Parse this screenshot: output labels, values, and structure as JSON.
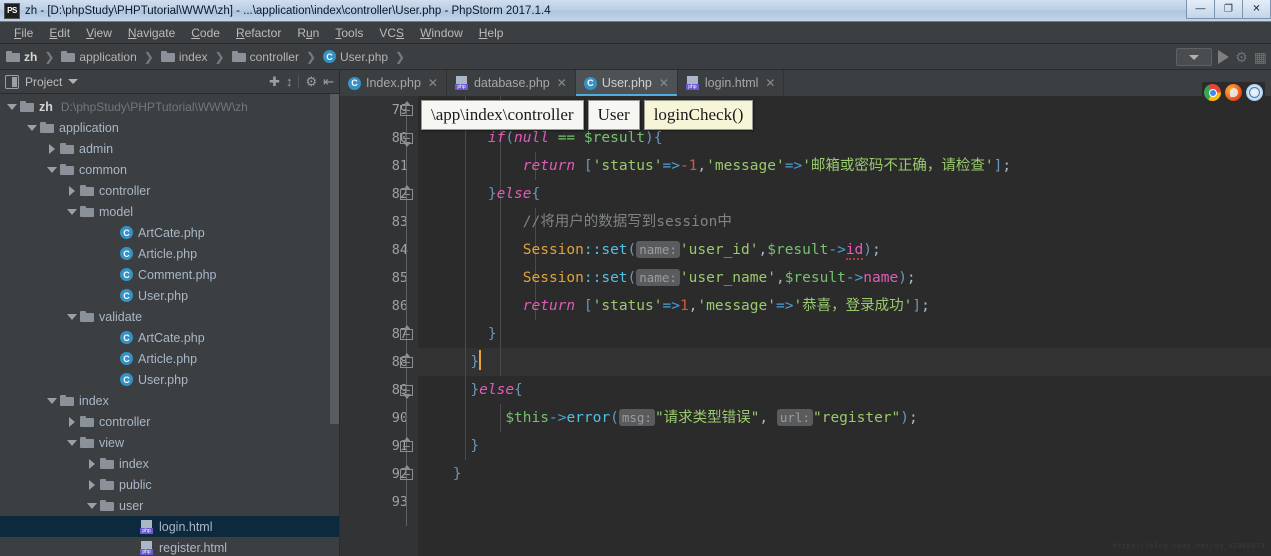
{
  "window": {
    "title": "zh - [D:\\phpStudy\\PHPTutorial\\WWW\\zh] - ...\\application\\index\\controller\\User.php - PhpStorm 2017.1.4",
    "app_icon_label": "PS",
    "controls": {
      "minimize": "—",
      "maximize": "❐",
      "close": "✕"
    }
  },
  "menubar": {
    "items": [
      {
        "pre": "",
        "mn": "F",
        "post": "ile"
      },
      {
        "pre": "",
        "mn": "E",
        "post": "dit"
      },
      {
        "pre": "",
        "mn": "V",
        "post": "iew"
      },
      {
        "pre": "",
        "mn": "N",
        "post": "avigate"
      },
      {
        "pre": "",
        "mn": "C",
        "post": "ode"
      },
      {
        "pre": "",
        "mn": "R",
        "post": "efactor"
      },
      {
        "pre": "R",
        "mn": "u",
        "post": "n"
      },
      {
        "pre": "",
        "mn": "T",
        "post": "ools"
      },
      {
        "pre": "VC",
        "mn": "S",
        "post": ""
      },
      {
        "pre": "",
        "mn": "W",
        "post": "indow"
      },
      {
        "pre": "",
        "mn": "H",
        "post": "elp"
      }
    ]
  },
  "navbar": {
    "crumbs": [
      {
        "label": "zh",
        "icon": "folder-icon",
        "bold": true
      },
      {
        "label": "application",
        "icon": "folder-icon",
        "bold": false
      },
      {
        "label": "index",
        "icon": "folder-icon",
        "bold": false
      },
      {
        "label": "controller",
        "icon": "folder-icon",
        "bold": false
      },
      {
        "label": "User.php",
        "icon": "php-class-icon",
        "bold": false
      }
    ],
    "separator": "❯"
  },
  "project_panel": {
    "title": "Project",
    "icons": [
      "locate-icon",
      "collapse-all-icon",
      "settings-gear-icon",
      "hide-panel-icon"
    ],
    "tree": [
      {
        "depth": 0,
        "twist": "open",
        "icon": "folder-icon",
        "label": "zh",
        "bold": true,
        "path": "D:\\phpStudy\\PHPTutorial\\WWW\\zh",
        "selected": false
      },
      {
        "depth": 1,
        "twist": "open",
        "icon": "folder-icon",
        "label": "application",
        "bold": false,
        "path": "",
        "selected": false
      },
      {
        "depth": 2,
        "twist": "closed",
        "icon": "folder-icon",
        "label": "admin",
        "bold": false,
        "path": "",
        "selected": false
      },
      {
        "depth": 2,
        "twist": "open",
        "icon": "folder-icon",
        "label": "common",
        "bold": false,
        "path": "",
        "selected": false
      },
      {
        "depth": 3,
        "twist": "closed",
        "icon": "folder-icon",
        "label": "controller",
        "bold": false,
        "path": "",
        "selected": false
      },
      {
        "depth": 3,
        "twist": "open",
        "icon": "folder-icon",
        "label": "model",
        "bold": false,
        "path": "",
        "selected": false
      },
      {
        "depth": 5,
        "twist": "none",
        "icon": "php-class-icon",
        "label": "ArtCate.php",
        "bold": false,
        "path": "",
        "selected": false
      },
      {
        "depth": 5,
        "twist": "none",
        "icon": "php-class-icon",
        "label": "Article.php",
        "bold": false,
        "path": "",
        "selected": false
      },
      {
        "depth": 5,
        "twist": "none",
        "icon": "php-class-icon",
        "label": "Comment.php",
        "bold": false,
        "path": "",
        "selected": false
      },
      {
        "depth": 5,
        "twist": "none",
        "icon": "php-class-icon",
        "label": "User.php",
        "bold": false,
        "path": "",
        "selected": false
      },
      {
        "depth": 3,
        "twist": "open",
        "icon": "folder-icon",
        "label": "validate",
        "bold": false,
        "path": "",
        "selected": false
      },
      {
        "depth": 5,
        "twist": "none",
        "icon": "php-class-icon",
        "label": "ArtCate.php",
        "bold": false,
        "path": "",
        "selected": false
      },
      {
        "depth": 5,
        "twist": "none",
        "icon": "php-class-icon",
        "label": "Article.php",
        "bold": false,
        "path": "",
        "selected": false
      },
      {
        "depth": 5,
        "twist": "none",
        "icon": "php-class-icon",
        "label": "User.php",
        "bold": false,
        "path": "",
        "selected": false
      },
      {
        "depth": 2,
        "twist": "open",
        "icon": "folder-icon",
        "label": "index",
        "bold": false,
        "path": "",
        "selected": false
      },
      {
        "depth": 3,
        "twist": "closed",
        "icon": "folder-icon",
        "label": "controller",
        "bold": false,
        "path": "",
        "selected": false
      },
      {
        "depth": 3,
        "twist": "open",
        "icon": "folder-icon",
        "label": "view",
        "bold": false,
        "path": "",
        "selected": false
      },
      {
        "depth": 4,
        "twist": "closed",
        "icon": "folder-icon",
        "label": "index",
        "bold": false,
        "path": "",
        "selected": false
      },
      {
        "depth": 4,
        "twist": "closed",
        "icon": "folder-icon",
        "label": "public",
        "bold": false,
        "path": "",
        "selected": false
      },
      {
        "depth": 4,
        "twist": "open",
        "icon": "folder-icon",
        "label": "user",
        "bold": false,
        "path": "",
        "selected": false
      },
      {
        "depth": 6,
        "twist": "none",
        "icon": "php-file-icon",
        "label": "login.html",
        "bold": false,
        "path": "",
        "selected": true
      },
      {
        "depth": 6,
        "twist": "none",
        "icon": "php-file-icon",
        "label": "register.html",
        "bold": false,
        "path": "",
        "selected": false
      }
    ]
  },
  "tabs": [
    {
      "label": "Index.php",
      "icon": "php-class-icon",
      "active": false,
      "close": "✕"
    },
    {
      "label": "database.php",
      "icon": "php-file-icon",
      "active": false,
      "close": "✕"
    },
    {
      "label": "User.php",
      "icon": "php-class-icon",
      "active": true,
      "close": "✕"
    },
    {
      "label": "login.html",
      "icon": "php-file-icon",
      "active": false,
      "close": "✕"
    }
  ],
  "breadcrumb_popup": [
    {
      "text": "\\app\\index\\controller",
      "highlight": false
    },
    {
      "text": "User",
      "highlight": false
    },
    {
      "text": "loginCheck()",
      "highlight": true
    }
  ],
  "run_toolbar": {
    "config_selector": "run-config-dropdown",
    "run_button": "run-icon",
    "debug_button": "debug-icon",
    "coverage_button": "coverage-icon"
  },
  "browser_bar": [
    "chrome-icon",
    "firefox-icon",
    "safari-icon"
  ],
  "editor": {
    "first_line": 79,
    "current_line": 88,
    "lines": [
      {
        "n": 79,
        "indent": 2,
        "fold": "mid-cap-top",
        "tokens": [
          {
            "t": "        ",
            "c": "t-punc"
          },
          {
            "t": "})",
            "c": "t-brc"
          },
          {
            "t": ";",
            "c": "t-punc"
          }
        ]
      },
      {
        "n": 80,
        "indent": 2,
        "fold": "mid-cap-bottom",
        "tokens": [
          {
            "t": "        ",
            "c": "t-punc"
          },
          {
            "t": "if",
            "c": "t-kw2"
          },
          {
            "t": "(",
            "c": "t-brc"
          },
          {
            "t": "null",
            "c": "t-kw2"
          },
          {
            "t": " ",
            "c": "t-punc"
          },
          {
            "t": "==",
            "c": "t-var"
          },
          {
            "t": " ",
            "c": "t-punc"
          },
          {
            "t": "$result",
            "c": "t-var"
          },
          {
            "t": ")",
            "c": "t-brc"
          },
          {
            "t": "{",
            "c": "t-brc"
          }
        ]
      },
      {
        "n": 81,
        "indent": 3,
        "fold": "none",
        "tokens": [
          {
            "t": "            ",
            "c": "t-punc"
          },
          {
            "t": "return",
            "c": "t-kw2"
          },
          {
            "t": " ",
            "c": "t-punc"
          },
          {
            "t": "[",
            "c": "t-brc"
          },
          {
            "t": "'status'",
            "c": "t-str"
          },
          {
            "t": "=>",
            "c": "t-op"
          },
          {
            "t": "-1",
            "c": "t-num"
          },
          {
            "t": ",",
            "c": "t-punc"
          },
          {
            "t": "'message'",
            "c": "t-str"
          },
          {
            "t": "=>",
            "c": "t-op"
          },
          {
            "t": "'邮箱或密码不正确，请检查'",
            "c": "t-str"
          },
          {
            "t": "]",
            "c": "t-brc"
          },
          {
            "t": ";",
            "c": "t-punc"
          }
        ]
      },
      {
        "n": 82,
        "indent": 2,
        "fold": "cap-top",
        "tokens": [
          {
            "t": "        ",
            "c": "t-punc"
          },
          {
            "t": "}",
            "c": "t-brc"
          },
          {
            "t": "else",
            "c": "t-kw2"
          },
          {
            "t": "{",
            "c": "t-brc"
          }
        ]
      },
      {
        "n": 83,
        "indent": 3,
        "fold": "none",
        "tokens": [
          {
            "t": "            ",
            "c": "t-punc"
          },
          {
            "t": "//将用户的数据写到session中",
            "c": "t-cmt"
          }
        ]
      },
      {
        "n": 84,
        "indent": 3,
        "fold": "none",
        "tokens": [
          {
            "t": "            ",
            "c": "t-punc"
          },
          {
            "t": "Session",
            "c": "t-cls"
          },
          {
            "t": "::",
            "c": "t-fn"
          },
          {
            "t": "set",
            "c": "t-fn"
          },
          {
            "t": "(",
            "c": "t-brc"
          },
          {
            "t": "name:",
            "c": "hint"
          },
          {
            "t": "'user_id'",
            "c": "t-str"
          },
          {
            "t": ",",
            "c": "t-punc"
          },
          {
            "t": "$result",
            "c": "t-var"
          },
          {
            "t": "->",
            "c": "t-op"
          },
          {
            "t": "id",
            "c": "t-prop sq"
          },
          {
            "t": ")",
            "c": "t-brc"
          },
          {
            "t": ";",
            "c": "t-punc"
          }
        ]
      },
      {
        "n": 85,
        "indent": 3,
        "fold": "none",
        "tokens": [
          {
            "t": "            ",
            "c": "t-punc"
          },
          {
            "t": "Session",
            "c": "t-cls"
          },
          {
            "t": "::",
            "c": "t-fn"
          },
          {
            "t": "set",
            "c": "t-fn"
          },
          {
            "t": "(",
            "c": "t-brc"
          },
          {
            "t": "name:",
            "c": "hint"
          },
          {
            "t": "'user_name'",
            "c": "t-str"
          },
          {
            "t": ",",
            "c": "t-punc"
          },
          {
            "t": "$result",
            "c": "t-var"
          },
          {
            "t": "->",
            "c": "t-op"
          },
          {
            "t": "name",
            "c": "t-prop"
          },
          {
            "t": ")",
            "c": "t-brc"
          },
          {
            "t": ";",
            "c": "t-punc"
          }
        ]
      },
      {
        "n": 86,
        "indent": 3,
        "fold": "none",
        "tokens": [
          {
            "t": "            ",
            "c": "t-punc"
          },
          {
            "t": "return",
            "c": "t-kw2"
          },
          {
            "t": " ",
            "c": "t-punc"
          },
          {
            "t": "[",
            "c": "t-brc"
          },
          {
            "t": "'status'",
            "c": "t-str"
          },
          {
            "t": "=>",
            "c": "t-op"
          },
          {
            "t": "1",
            "c": "t-num"
          },
          {
            "t": ",",
            "c": "t-punc"
          },
          {
            "t": "'message'",
            "c": "t-str"
          },
          {
            "t": "=>",
            "c": "t-op"
          },
          {
            "t": "'恭喜，登录成功'",
            "c": "t-str"
          },
          {
            "t": "]",
            "c": "t-brc"
          },
          {
            "t": ";",
            "c": "t-punc"
          }
        ]
      },
      {
        "n": 87,
        "indent": 2,
        "fold": "cap-top",
        "tokens": [
          {
            "t": "        ",
            "c": "t-punc"
          },
          {
            "t": "}",
            "c": "t-brc"
          }
        ]
      },
      {
        "n": 88,
        "indent": 2,
        "fold": "cap-top",
        "tokens": [
          {
            "t": "      ",
            "c": "t-punc"
          },
          {
            "t": "}",
            "c": "t-brc"
          },
          {
            "t": "|CARET|",
            "c": "caret"
          }
        ]
      },
      {
        "n": 89,
        "indent": 1,
        "fold": "mid-cap-bottom",
        "tokens": [
          {
            "t": "      ",
            "c": "t-punc"
          },
          {
            "t": "}",
            "c": "t-brc"
          },
          {
            "t": "else",
            "c": "t-kw2"
          },
          {
            "t": "{",
            "c": "t-brc"
          }
        ]
      },
      {
        "n": 90,
        "indent": 2,
        "fold": "none",
        "tokens": [
          {
            "t": "          ",
            "c": "t-punc"
          },
          {
            "t": "$this",
            "c": "t-var"
          },
          {
            "t": "->",
            "c": "t-op"
          },
          {
            "t": "error",
            "c": "t-fn"
          },
          {
            "t": "(",
            "c": "t-brc"
          },
          {
            "t": "msg:",
            "c": "hint"
          },
          {
            "t": "\"请求类型错误\"",
            "c": "t-str"
          },
          {
            "t": ", ",
            "c": "t-punc"
          },
          {
            "t": "url:",
            "c": "hint"
          },
          {
            "t": "\"register\"",
            "c": "t-str"
          },
          {
            "t": ")",
            "c": "t-brc"
          },
          {
            "t": ";",
            "c": "t-punc"
          }
        ]
      },
      {
        "n": 91,
        "indent": 1,
        "fold": "cap-top",
        "tokens": [
          {
            "t": "      ",
            "c": "t-punc"
          },
          {
            "t": "}",
            "c": "t-brc"
          }
        ]
      },
      {
        "n": 92,
        "indent": 0,
        "fold": "cap-top",
        "tokens": [
          {
            "t": "    ",
            "c": "t-punc"
          },
          {
            "t": "}",
            "c": "t-brc"
          }
        ]
      },
      {
        "n": 93,
        "indent": 0,
        "fold": "none",
        "tokens": []
      }
    ]
  },
  "watermark": "https://blog.csdn.net/qq_42969973",
  "colors": {
    "accent": "#4eaee3",
    "editor_bg": "#2b2b2b",
    "gutter_bg": "#313335",
    "panel_bg": "#3c3f41",
    "selection": "#0d293e",
    "caret": "#e8a33d"
  }
}
